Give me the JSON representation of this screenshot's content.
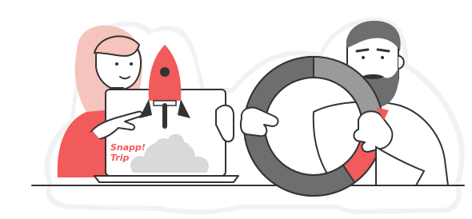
{
  "illustration": {
    "brand": {
      "line1": "Snapp!",
      "line2": "Trip"
    },
    "colors": {
      "accent": "#f15b5b",
      "accent_light": "#f5c4bc",
      "dark_gray": "#6e6e6e",
      "mid_gray": "#9a9a9a",
      "light_gray": "#d9d9d9",
      "outline": "#333333",
      "sticker_shadow": "#eeeeee"
    },
    "icons": [
      "rocket-icon",
      "pie-chart-ring-icon",
      "laptop-icon"
    ]
  }
}
